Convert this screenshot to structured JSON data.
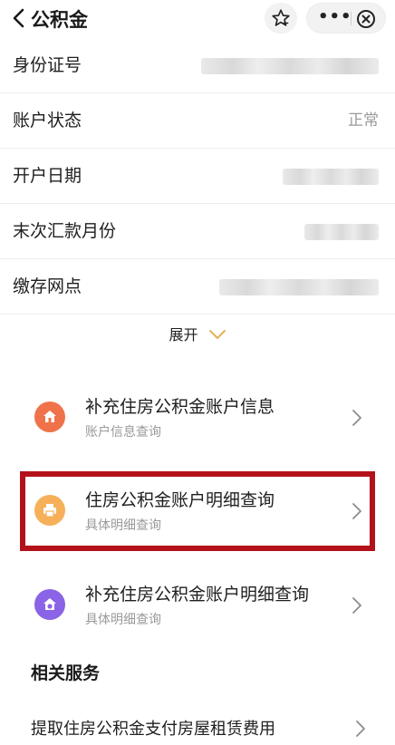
{
  "header": {
    "title": "公积金",
    "back_icon": "chevron-left-icon",
    "star_icon": "star-outline-icon",
    "more_icon": "more-dots-icon",
    "more_label": "•••",
    "close_icon": "close-circle-icon"
  },
  "info_rows": [
    {
      "label": "身份证号",
      "value": ""
    },
    {
      "label": "账户状态",
      "value": "正常"
    },
    {
      "label": "开户日期",
      "value": ""
    },
    {
      "label": "末次汇款月份",
      "value": ""
    },
    {
      "label": "缴存网点",
      "value": ""
    }
  ],
  "expand": {
    "label": "展开",
    "icon": "chevron-down-icon"
  },
  "service_cards": [
    {
      "title": "补充住房公积金账户信息",
      "subtitle": "账户信息查询",
      "icon": "house-icon",
      "icon_color": "#f0724a"
    },
    {
      "title": "住房公积金账户明细查询",
      "subtitle": "具体明细查询",
      "icon": "printer-icon",
      "icon_color": "#f6b05a",
      "highlighted": true
    },
    {
      "title": "补充住房公积金账户明细查询",
      "subtitle": "具体明细查询",
      "icon": "house-money-icon",
      "icon_color": "#8a63e6"
    }
  ],
  "related": {
    "title": "相关服务",
    "items": [
      {
        "label": "提取住房公积金支付房屋租赁费用"
      }
    ]
  },
  "colors": {
    "highlight_border": "#b3121a",
    "accent_gold": "#e2b25b",
    "muted_text": "#9a9a9a"
  }
}
